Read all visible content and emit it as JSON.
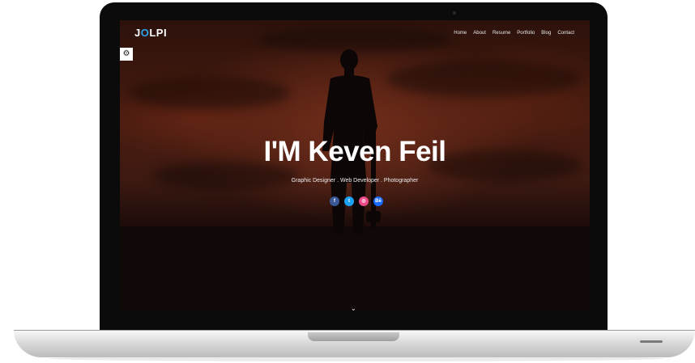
{
  "brand": {
    "prefix": "J",
    "o_letter": "O",
    "suffix": "LPI"
  },
  "nav": {
    "items": [
      "Home",
      "About",
      "Resume",
      "Portfolio",
      "Blog",
      "Contact"
    ]
  },
  "settings_icon": "gear-icon",
  "hero": {
    "title": "I'M Keven Feil",
    "subtitle": "Graphic Designer . Web Developer . Photographer"
  },
  "social": [
    {
      "name": "facebook-icon",
      "glyph": "f",
      "color": "#3b5998"
    },
    {
      "name": "twitter-icon",
      "glyph": "t",
      "color": "#1da1f2"
    },
    {
      "name": "dribbble-icon",
      "glyph": "◎",
      "color": "#ea4c89"
    },
    {
      "name": "behance-icon",
      "glyph": "Bē",
      "color": "#1769ff"
    }
  ],
  "scroll_icon": "chevron-down-icon",
  "colors": {
    "accent": "#2ea3f2",
    "screen_bg": "#2c120b"
  }
}
